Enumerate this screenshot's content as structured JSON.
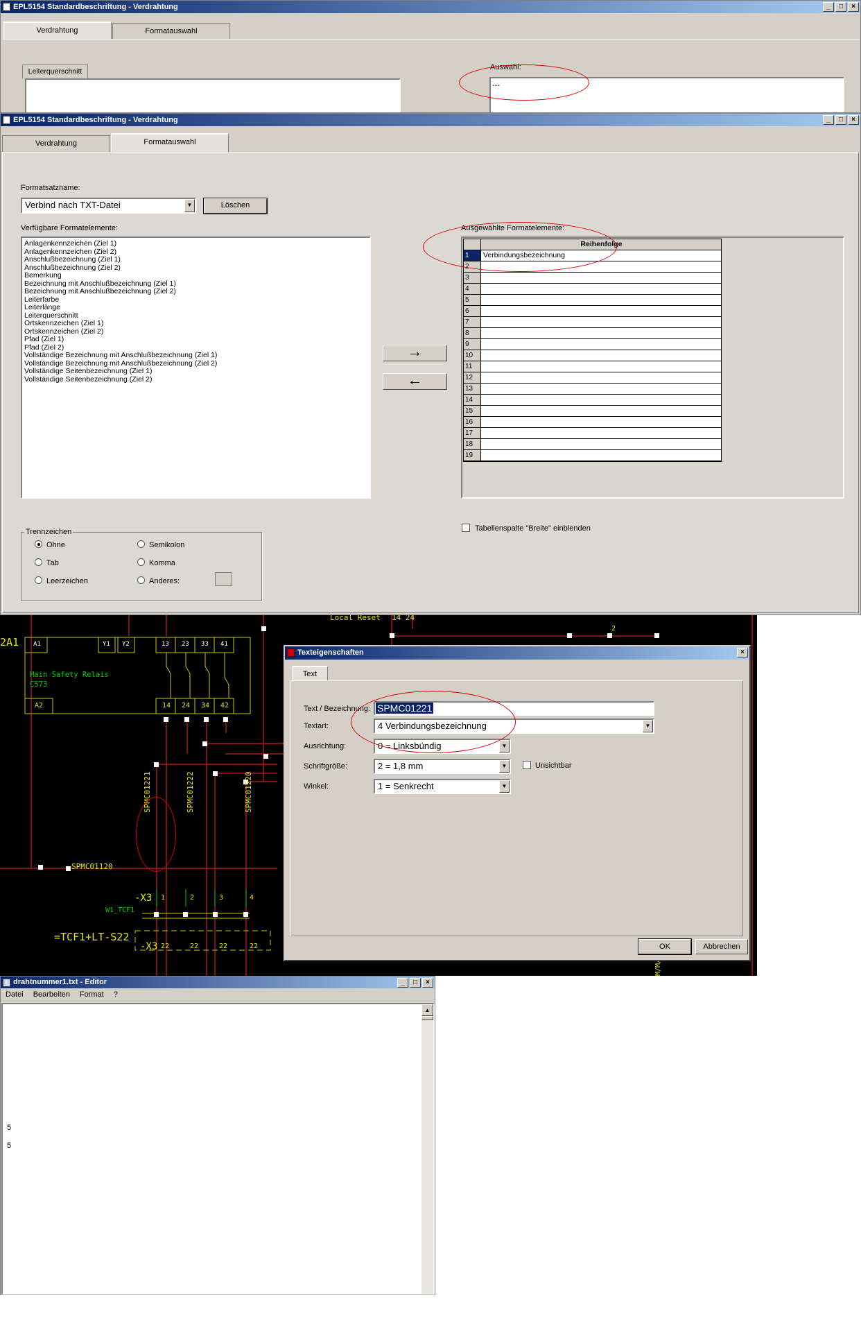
{
  "win1": {
    "title": "EPL5154 Standardbeschriftung - Verdrahtung",
    "tab_wiring": "Verdrahtung",
    "tab_format": "Formatauswahl",
    "cross_section_label": "Leiterquerschnitt",
    "selection_label": "Auswahl:",
    "selection_value": "---"
  },
  "win2": {
    "title": "EPL5154 Standardbeschriftung - Verdrahtung",
    "tab_wiring": "Verdrahtung",
    "tab_format": "Formatauswahl",
    "format_name_label": "Formatsatzname:",
    "format_name_value": "Verbind nach TXT-Datei",
    "delete_button": "Löschen",
    "available_label": "Verfügbare Formatelemente:",
    "available_items": [
      "Anlagenkennzeichen (Ziel 1)",
      "Anlagenkennzeichen (Ziel 2)",
      "Anschlußbezeichnung (Ziel 1)",
      "Anschlußbezeichnung (Ziel 2)",
      "Bemerkung",
      "Bezeichnung mit Anschlußbezeichnung (Ziel 1)",
      "Bezeichnung mit Anschlußbezeichnung (Ziel 2)",
      "Leiterfarbe",
      "Leiterlänge",
      "Leiterquerschnitt",
      "Ortskennzeichen (Ziel 1)",
      "Ortskennzeichen (Ziel 2)",
      "Pfad (Ziel 1)",
      "Pfad (Ziel 2)",
      "Vollständige Bezeichnung mit Anschlußbezeichnung (Ziel 1)",
      "Vollständige Bezeichnung mit Anschlußbezeichnung (Ziel 2)",
      "Vollständige Seitenbezeichnung (Ziel 1)",
      "Vollständige Seitenbezeichnung (Ziel 2)"
    ],
    "add_arrow": "→",
    "remove_arrow": "←",
    "selected_label": "Ausgewählte Formatelemente:",
    "grid_header": "Reihenfolge",
    "grid_rows": [
      {
        "n": "1",
        "v": "Verbindungsbezeichnung"
      },
      {
        "n": "2",
        "v": ""
      },
      {
        "n": "3",
        "v": ""
      },
      {
        "n": "4",
        "v": ""
      },
      {
        "n": "5",
        "v": ""
      },
      {
        "n": "6",
        "v": ""
      },
      {
        "n": "7",
        "v": ""
      },
      {
        "n": "8",
        "v": ""
      },
      {
        "n": "9",
        "v": ""
      },
      {
        "n": "10",
        "v": ""
      },
      {
        "n": "11",
        "v": ""
      },
      {
        "n": "12",
        "v": ""
      },
      {
        "n": "13",
        "v": ""
      },
      {
        "n": "14",
        "v": ""
      },
      {
        "n": "15",
        "v": ""
      },
      {
        "n": "16",
        "v": ""
      },
      {
        "n": "17",
        "v": ""
      },
      {
        "n": "18",
        "v": ""
      },
      {
        "n": "19",
        "v": ""
      }
    ],
    "separator_group": "Trennzeichen",
    "sep_none": "Ohne",
    "sep_tab": "Tab",
    "sep_space": "Leerzeichen",
    "sep_semicolon": "Semikolon",
    "sep_comma": "Komma",
    "sep_other": "Anderes:",
    "show_width_checkbox": "Tabellenspalte \"Breite\" einblenden"
  },
  "cad": {
    "relay_id": "2A1",
    "relay_title": "Main Safety Relais",
    "relay_model": "C573",
    "pins_top": [
      "A1",
      "Y1",
      "Y2",
      "13",
      "23",
      "33",
      "41"
    ],
    "pins_bottom": [
      "A2",
      "14",
      "24",
      "34",
      "42"
    ],
    "local_reset": "Local Reset",
    "lr_pins": "14 24",
    "wire_labels": [
      "SPMC01221",
      "SPMC01222",
      "SPMC01220"
    ],
    "wire_label_h": "SPMC01120",
    "terminal": "-X3",
    "terminal_nums": [
      "1",
      "2",
      "3",
      "4"
    ],
    "cable": "W1_TCF1",
    "location": "=TCF1+LT-S22",
    "terminal2": "-X3",
    "t2_nums": [
      "22",
      "22",
      "22",
      "22"
    ],
    "right_num": "2",
    "v_text": "M/M/M"
  },
  "dialog": {
    "title": "Texteigenschaften",
    "tab": "Text",
    "text_label": "Text / Bezeichnung:",
    "text_value": "SPMC01221",
    "type_label": "Textart:",
    "type_value": "4 Verbindungsbezeichnung",
    "align_label": "Ausrichtung:",
    "align_value": "0 = Linksbündig",
    "size_label": "Schriftgröße:",
    "size_value": "2 = 1,8 mm",
    "invisible_label": "Unsichtbar",
    "angle_label": "Winkel:",
    "angle_value": "1 = Senkrecht",
    "ok": "OK",
    "cancel": "Abbrechen"
  },
  "editor": {
    "title": "drahtnummer1.txt - Editor",
    "menu": [
      "Datei",
      "Bearbeiten",
      "Format",
      "?"
    ],
    "lines": [
      "5",
      "5"
    ]
  },
  "colors": {
    "title_start": "#0a246a",
    "title_end": "#a6caf0",
    "annotation": "#dd0000",
    "cad_bg": "#000000",
    "cad_yellow": "#e6e600",
    "cad_green": "#00cc00",
    "cad_red": "#cc2222"
  }
}
